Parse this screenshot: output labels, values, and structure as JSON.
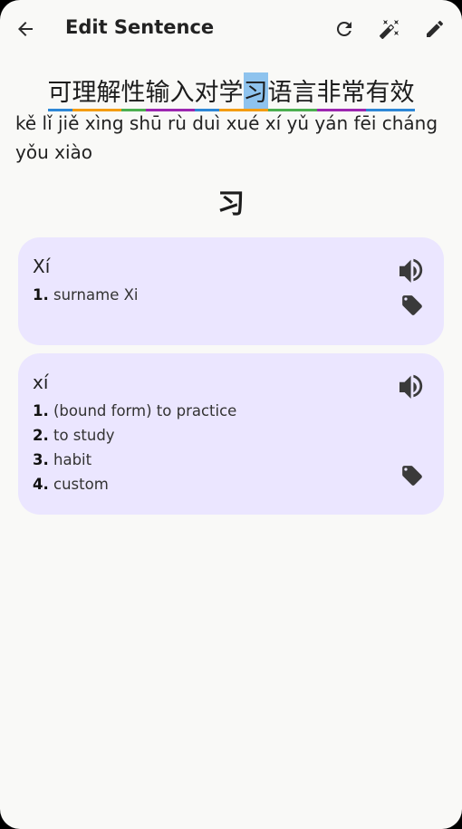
{
  "appbar": {
    "title": "Edit Sentence"
  },
  "sentence": {
    "words": [
      {
        "text": "可",
        "color": "#2e87d6"
      },
      {
        "text": "理解",
        "color": "#f39c12"
      },
      {
        "text": "性",
        "color": "#4caf50"
      },
      {
        "text": "输入",
        "color": "#9c27b0"
      },
      {
        "text": "对",
        "color": "#2e87d6"
      },
      {
        "text": "学",
        "color": "#f39c12"
      },
      {
        "text": "习",
        "color": "#f39c12"
      },
      {
        "text": "语言",
        "color": "#4caf50"
      },
      {
        "text": "非常",
        "color": "#9c27b0"
      },
      {
        "text": "有效",
        "color": "#2e87d6"
      }
    ],
    "highlighted_char": "习",
    "highlight_color": "#8ec3ee",
    "pinyin": "kě lǐ jiě xìng shū rù duì xué xí yǔ yán fēi cháng yǒu xiào"
  },
  "selected": {
    "hanzi": "习"
  },
  "entries": [
    {
      "pinyin": "Xí",
      "definitions": [
        {
          "num": "1.",
          "text": "surname Xi"
        }
      ]
    },
    {
      "pinyin": "xí",
      "definitions": [
        {
          "num": "1.",
          "text": "(bound form) to practice"
        },
        {
          "num": "2.",
          "text": "to study"
        },
        {
          "num": "3.",
          "text": "habit"
        },
        {
          "num": "4.",
          "text": "custom"
        }
      ]
    }
  ],
  "icons": {
    "back": "arrow-back-icon",
    "refresh": "refresh-icon",
    "magic": "magic-wand-icon",
    "edit": "pencil-icon",
    "speaker": "volume-up-icon",
    "tag": "tag-icon"
  },
  "colors": {
    "card_bg": "#ebe6ff",
    "screen_bg": "#f9f9f7"
  }
}
